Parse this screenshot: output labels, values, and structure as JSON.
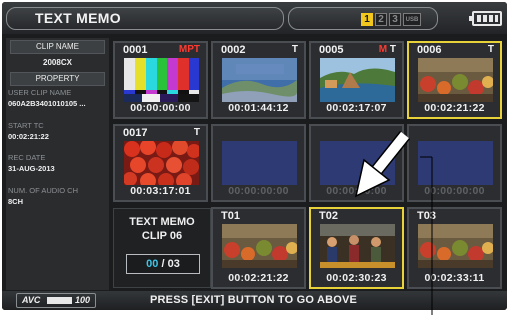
{
  "header": {
    "title": "TEXT MEMO",
    "slots": [
      "1",
      "2",
      "3",
      "USB"
    ],
    "active_slot": "1",
    "battery_icon": "battery-full-icon"
  },
  "left_panel": {
    "clip_name_header": "CLIP NAME",
    "clip_name_value": "2008CX",
    "property_header": "PROPERTY",
    "user_clip_name_label": "USER CLIP NAME",
    "user_clip_name_value": "060A2B3401010105 ...",
    "start_tc_label": "START TC",
    "start_tc_value": "00:02:21:22",
    "rec_date_label": "REC DATE",
    "rec_date_value": "31-AUG-2013",
    "audio_ch_label": "NUM. OF AUDIO CH",
    "audio_ch_value": "8CH"
  },
  "clips": [
    {
      "number": "0001",
      "indicator_m": "",
      "indicator": "MPT",
      "timecode": "00:00:00:00",
      "image": "color-bars",
      "selected": false,
      "empty": false
    },
    {
      "number": "0002",
      "indicator_m": "",
      "indicator": "T",
      "timecode": "00:01:44:12",
      "image": "coastline-postcard",
      "selected": false,
      "empty": false
    },
    {
      "number": "0005",
      "indicator_m": "M",
      "indicator": "T",
      "timecode": "00:02:17:07",
      "image": "seaside-cliffs",
      "selected": false,
      "empty": false
    },
    {
      "number": "0006",
      "indicator_m": "",
      "indicator": "T",
      "timecode": "00:02:21:22",
      "image": "market-stall",
      "selected": true,
      "empty": false
    },
    {
      "number": "0017",
      "indicator_m": "",
      "indicator": "T",
      "timecode": "00:03:17:01",
      "image": "tomatoes",
      "selected": false,
      "empty": false
    },
    {
      "number": "",
      "indicator_m": "",
      "indicator": "",
      "timecode": "00:00:00:00",
      "image": "empty",
      "selected": false,
      "empty": true
    },
    {
      "number": "",
      "indicator_m": "",
      "indicator": "",
      "timecode": "00:00:00:00",
      "image": "empty",
      "selected": false,
      "empty": true
    },
    {
      "number": "",
      "indicator_m": "",
      "indicator": "",
      "timecode": "00:00:00:00",
      "image": "empty",
      "selected": false,
      "empty": true
    }
  ],
  "text_memo": {
    "title_line1": "TEXT MEMO",
    "title_line2": "CLIP 06",
    "current": "00",
    "separator": " / ",
    "total": "03"
  },
  "memos": [
    {
      "label": "T01",
      "timecode": "00:02:21:22",
      "image": "market-stall",
      "selected": false
    },
    {
      "label": "T02",
      "timecode": "00:02:30:23",
      "image": "market-crowd",
      "selected": true
    },
    {
      "label": "T03",
      "timecode": "00:02:33:11",
      "image": "market-stall",
      "selected": false
    }
  ],
  "footer": {
    "codec_prefix": "AVC",
    "codec_number": "100",
    "message": "PRESS [EXIT] BUTTON TO GO ABOVE"
  },
  "colors": {
    "selection": "#e8d23a",
    "active_slot": "#f2c81e",
    "counter_current": "#3fc4e6",
    "empty_frame": "#2d3a73",
    "m_indicator": "#ff3a30"
  }
}
